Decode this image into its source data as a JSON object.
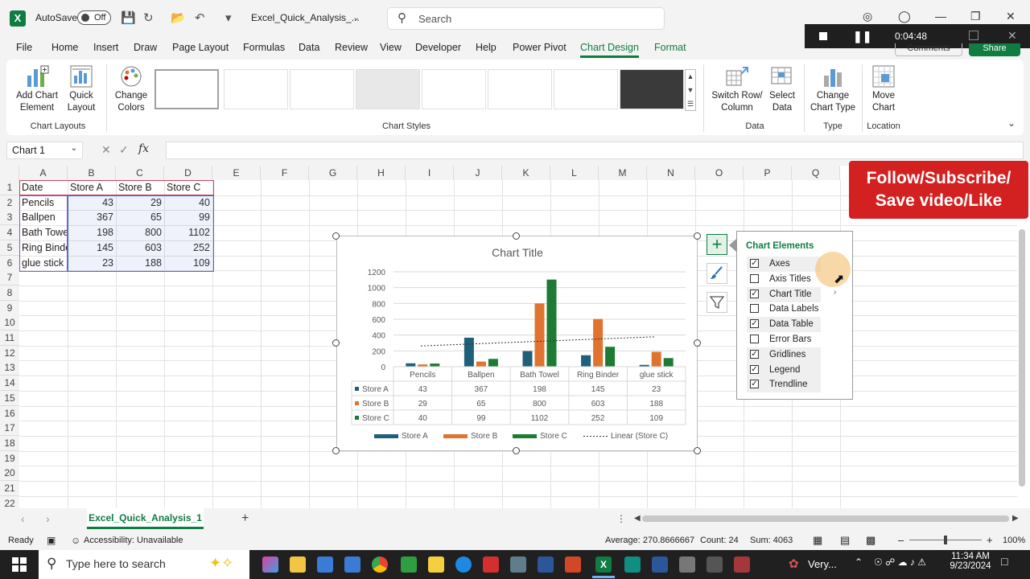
{
  "titlebar": {
    "app_icon": "X",
    "autosave_label": "AutoSave",
    "autosave_state": "Off",
    "filename": "Excel_Quick_Analysis_...",
    "search_placeholder": "Search"
  },
  "recorder": {
    "time": "0:04:48"
  },
  "menu": {
    "tabs": [
      "File",
      "Home",
      "Insert",
      "Draw",
      "Page Layout",
      "Formulas",
      "Data",
      "Review",
      "View",
      "Developer",
      "Help",
      "Power Pivot",
      "Chart Design",
      "Format"
    ],
    "active": "Chart Design",
    "comments": "Comments",
    "share": "Share"
  },
  "ribbon": {
    "add_chart_element": [
      "Add Chart",
      "Element"
    ],
    "quick_layout": [
      "Quick",
      "Layout"
    ],
    "change_colors": [
      "Change",
      "Colors"
    ],
    "switch_row_col": [
      "Switch Row/",
      "Column"
    ],
    "select_data": [
      "Select",
      "Data"
    ],
    "change_chart_type": [
      "Change",
      "Chart Type"
    ],
    "move_chart": [
      "Move",
      "Chart"
    ],
    "groups": {
      "chart_layouts": "Chart Layouts",
      "chart_styles": "Chart Styles",
      "data": "Data",
      "type": "Type",
      "location": "Location"
    }
  },
  "formula_bar": {
    "name_box": "Chart 1",
    "fx": "fx",
    "content": ""
  },
  "sheet": {
    "columns": [
      "A",
      "B",
      "C",
      "D",
      "E",
      "F",
      "G",
      "H",
      "I",
      "J",
      "K",
      "L",
      "M",
      "N",
      "O",
      "P",
      "Q"
    ],
    "rows": [
      "1",
      "2",
      "3",
      "4",
      "5",
      "6",
      "7",
      "8",
      "9",
      "10",
      "11",
      "12",
      "13",
      "14",
      "15",
      "16",
      "17",
      "18",
      "19",
      "20",
      "21",
      "22"
    ],
    "table": [
      [
        "Date",
        "Store A",
        "Store B",
        "Store C"
      ],
      [
        "Pencils",
        "43",
        "29",
        "40"
      ],
      [
        "Ballpen",
        "367",
        "65",
        "99"
      ],
      [
        "Bath Towe",
        "198",
        "800",
        "1102"
      ],
      [
        "Ring Binde",
        "145",
        "603",
        "252"
      ],
      [
        "glue stick",
        "23",
        "188",
        "109"
      ]
    ]
  },
  "chart_data": {
    "type": "bar",
    "title": "Chart Title",
    "categories": [
      "Pencils",
      "Ballpen",
      "Bath Towel",
      "Ring Binder",
      "glue stick"
    ],
    "series": [
      {
        "name": "Store A",
        "values": [
          43,
          367,
          198,
          145,
          23
        ],
        "color": "#1f5f7a"
      },
      {
        "name": "Store B",
        "values": [
          29,
          65,
          800,
          603,
          188
        ],
        "color": "#e0732e"
      },
      {
        "name": "Store C",
        "values": [
          40,
          99,
          1102,
          252,
          109
        ],
        "color": "#1e7b34"
      }
    ],
    "trendline": {
      "name": "Linear (Store C)",
      "series": "Store C"
    },
    "ylim": [
      0,
      1200
    ],
    "yticks": [
      0,
      200,
      400,
      600,
      800,
      1000,
      1200
    ],
    "gridlines": true,
    "legend": "bottom",
    "data_table": true
  },
  "chart_elements": {
    "title": "Chart Elements",
    "items": [
      {
        "label": "Axes",
        "checked": true
      },
      {
        "label": "Axis Titles",
        "checked": false
      },
      {
        "label": "Chart Title",
        "checked": true
      },
      {
        "label": "Data Labels",
        "checked": false
      },
      {
        "label": "Data Table",
        "checked": true
      },
      {
        "label": "Error Bars",
        "checked": false
      },
      {
        "label": "Gridlines",
        "checked": true
      },
      {
        "label": "Legend",
        "checked": true
      },
      {
        "label": "Trendline",
        "checked": true
      }
    ]
  },
  "banner": {
    "line1": "Follow/Subscribe/",
    "line2": "Save video/Like"
  },
  "sheet_tab": "Excel_Quick_Analysis_1",
  "status": {
    "ready": "Ready",
    "accessibility": "Accessibility: Unavailable",
    "average": "Average: 270.8666667",
    "count": "Count: 24",
    "sum": "Sum: 4063",
    "zoom": "100%"
  },
  "taskbar": {
    "search": "Type here to search",
    "weather": "Very...",
    "time": "11:34 AM",
    "date": "9/23/2024"
  }
}
